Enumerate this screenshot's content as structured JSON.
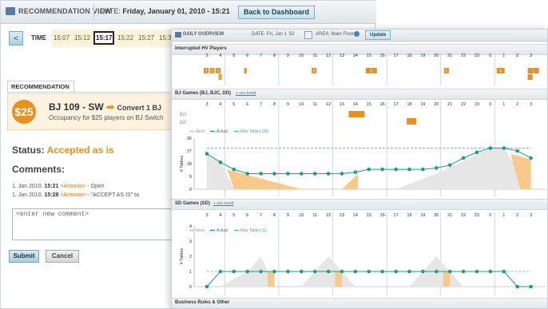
{
  "back_window": {
    "title": "RECOMMENDATION VIEW",
    "date_label": "DATE:",
    "date_value": "Friday, January 01, 2010 - 15:21",
    "back_button": "Back to Dashboard",
    "prev_button": "<",
    "time_label": "TIME",
    "times": [
      "15:07",
      "15:12",
      "15:17",
      "15:22",
      "15:27",
      "15:3"
    ],
    "selected_time": "15:17",
    "recommendation_tab": "RECOMMENDATION",
    "rec_amount": "$25",
    "rec_headline": "BJ 109 - SW",
    "rec_convert": "Convert 1 BJ",
    "rec_desc": "Occupancy for $25 players on BJ Switch",
    "status_label": "Status:",
    "status_value": "Accepted as is",
    "comments_label": "Comments:",
    "comments": [
      {
        "date": "1, Jan 2010.",
        "time": "15:21",
        "user": "<Antonio>",
        "text": "- Open"
      },
      {
        "date": "1, Jan 2010.",
        "time": "15:28",
        "user": "<Antonio>",
        "text": "- \"ACCEPT AS IS\" ta"
      }
    ],
    "comment_placeholder": "<enter new comment>",
    "submit_button": "Submit",
    "cancel_button": "Cancel"
  },
  "front_window": {
    "title": "DAILY OVERVIEW",
    "date_label": "DATE: Fri, Jan 1 '10",
    "area_label": "AREA: Main Floor",
    "update_button": "Update",
    "hour_ticks": [
      "3",
      "4",
      "5",
      "6",
      "7",
      "8",
      "9",
      "10",
      "11",
      "12",
      "13",
      "14",
      "15",
      "16",
      "17",
      "18",
      "19",
      "20",
      "21",
      "22",
      "23",
      "0",
      "1",
      "2",
      "3"
    ],
    "sections": {
      "hv": {
        "title": "Interrupted HV Players"
      },
      "bj": {
        "title": "BJ Games (BJ, BJC, DD)",
        "link": "+ see trend"
      },
      "sd": {
        "title": "SD Games (SD)",
        "link": "+ see trend"
      },
      "rules": {
        "title": "Business Rules & Other"
      }
    },
    "hv_counts": [
      "2",
      "2",
      "1",
      "1",
      "2",
      "3",
      "1",
      "4",
      "1"
    ],
    "bj_row_labels": [
      "$10",
      "$15"
    ],
    "legend": {
      "ideal": "Ideal",
      "actual": "Actual",
      "max": "Max Tables (29)"
    },
    "legend_sd": {
      "ideal": "Ideal",
      "actual": "Actual",
      "max": "Max Tables (1)"
    },
    "y_axis_label": "# Tables"
  },
  "chart_data": [
    {
      "type": "line",
      "title": "BJ Games (BJ, BJC, DD)",
      "ylabel": "# Tables",
      "ylim": [
        0,
        36
      ],
      "yticks": [
        0,
        9,
        18,
        27,
        36
      ],
      "x": [
        "3",
        "4",
        "5",
        "6",
        "7",
        "8",
        "9",
        "10",
        "11",
        "12",
        "13",
        "14",
        "15",
        "16",
        "17",
        "18",
        "19",
        "20",
        "21",
        "22",
        "23",
        "0",
        "1",
        "2",
        "3"
      ],
      "series": [
        {
          "name": "Actual",
          "values": [
            25,
            19,
            14,
            11,
            11,
            11,
            11,
            11,
            11,
            11,
            11,
            12,
            14,
            14,
            14,
            14,
            14,
            15,
            17,
            22,
            26,
            29,
            29,
            27,
            22
          ]
        },
        {
          "name": "Max Tables (29)",
          "values": [
            29,
            29,
            29,
            29,
            29,
            29,
            29,
            29,
            29,
            29,
            29,
            29,
            29,
            29,
            29,
            29,
            29,
            29,
            29,
            29,
            29,
            29,
            29,
            29,
            29
          ]
        }
      ]
    },
    {
      "type": "line",
      "title": "SD Games (SD)",
      "ylabel": "# Tables",
      "ylim": [
        0,
        4
      ],
      "yticks": [
        0,
        1,
        2,
        3,
        4
      ],
      "x": [
        "3",
        "4",
        "5",
        "6",
        "7",
        "8",
        "9",
        "10",
        "11",
        "12",
        "13",
        "14",
        "15",
        "16",
        "17",
        "18",
        "19",
        "20",
        "21",
        "22",
        "23",
        "0",
        "1",
        "2",
        "3"
      ],
      "series": [
        {
          "name": "Actual",
          "values": [
            0,
            1,
            1,
            1,
            1,
            1,
            1,
            1,
            1,
            1,
            1,
            1,
            1,
            1,
            1,
            1,
            1,
            1,
            1,
            1,
            1,
            1,
            1,
            0,
            0
          ]
        },
        {
          "name": "Max Tables (1)",
          "values": [
            1,
            1,
            1,
            1,
            1,
            1,
            1,
            1,
            1,
            1,
            1,
            1,
            1,
            1,
            1,
            1,
            1,
            1,
            1,
            1,
            1,
            1,
            1,
            1,
            1
          ]
        }
      ]
    }
  ],
  "colors": {
    "accent": "#e8911d",
    "actual": "#1f9e86",
    "max": "#47c0c6"
  }
}
